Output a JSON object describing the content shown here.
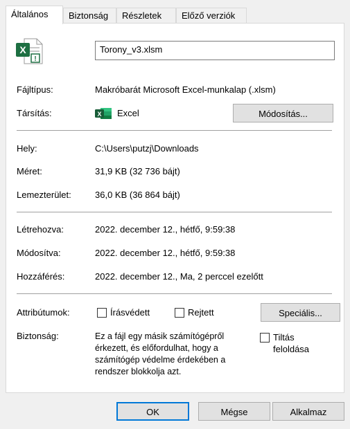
{
  "tabs": [
    "Általános",
    "Biztonság",
    "Részletek",
    "Előző verziók"
  ],
  "file_icon": "excel-macro-file-icon",
  "filename": "Torony_v3.xlsm",
  "labels": {
    "filetype": "Fájltípus:",
    "assoc": "Társítás:",
    "location": "Hely:",
    "size": "Méret:",
    "disk": "Lemezterület:",
    "created": "Létrehozva:",
    "modified": "Módosítva:",
    "accessed": "Hozzáférés:",
    "attributes": "Attribútumok:",
    "security": "Biztonság:"
  },
  "values": {
    "filetype": "Makróbarát Microsoft Excel-munkalap (.xlsm)",
    "assoc_app": "Excel",
    "location": "C:\\Users\\putzj\\Downloads",
    "size": "31,9 KB (32 736 bájt)",
    "disk": "36,0 KB (36 864 bájt)",
    "created": "2022. december 12., hétfő, 9:59:38",
    "modified": "2022. december 12., hétfő, 9:59:38",
    "accessed": "2022. december 12., Ma, 2 perccel ezelőtt",
    "security_text": "Ez a fájl egy másik számítógépről érkezett, és előfordulhat, hogy a számítógép védelme érdekében a rendszer blokkolja azt."
  },
  "buttons": {
    "change": "Módosítás...",
    "advanced": "Speciális...",
    "ok": "OK",
    "cancel": "Mégse",
    "apply": "Alkalmaz"
  },
  "checkboxes": {
    "readonly": {
      "label": "Írásvédett",
      "checked": false
    },
    "hidden": {
      "label": "Rejtett",
      "checked": false
    },
    "unblock": {
      "label": "Tiltás feloldása",
      "checked": false
    }
  },
  "colors": {
    "excel_green": "#1d6f42",
    "focus_blue": "#0078d7"
  }
}
